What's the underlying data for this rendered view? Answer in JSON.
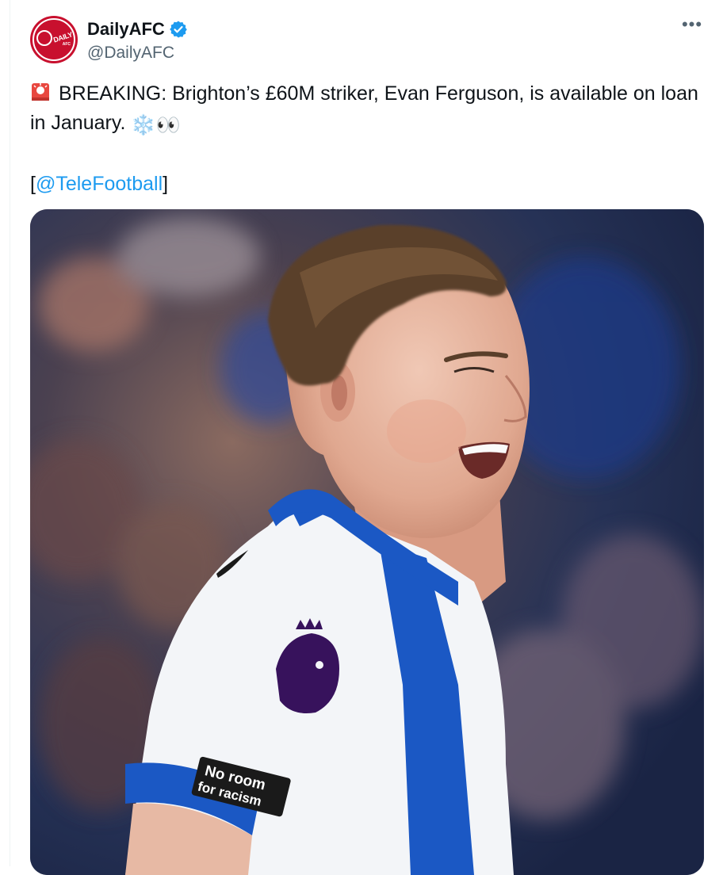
{
  "account": {
    "display_name": "DailyAFC",
    "handle": "@DailyAFC",
    "verified": true,
    "avatar_text": "DAILY",
    "avatar_subtext": "AFC"
  },
  "menu": {
    "more_label": "•••"
  },
  "tweet": {
    "line1_emoji": "siren-emoji",
    "text_main": "BREAKING: Brighton’s £60M striker, Evan Ferguson, is available on loan in January.",
    "trailing_emojis": "❄️👀",
    "source_prefix": "[",
    "mention": "@TeleFootball",
    "source_suffix": "]"
  },
  "media": {
    "jersey_patch_text_1": "No room",
    "jersey_patch_text_2": "for racism"
  },
  "colors": {
    "link": "#1d9bf0",
    "verified_badge": "#1d9bf0",
    "avatar_red": "#c8102e",
    "secondary_text": "#536471",
    "brighton_blue": "#0057b8"
  }
}
